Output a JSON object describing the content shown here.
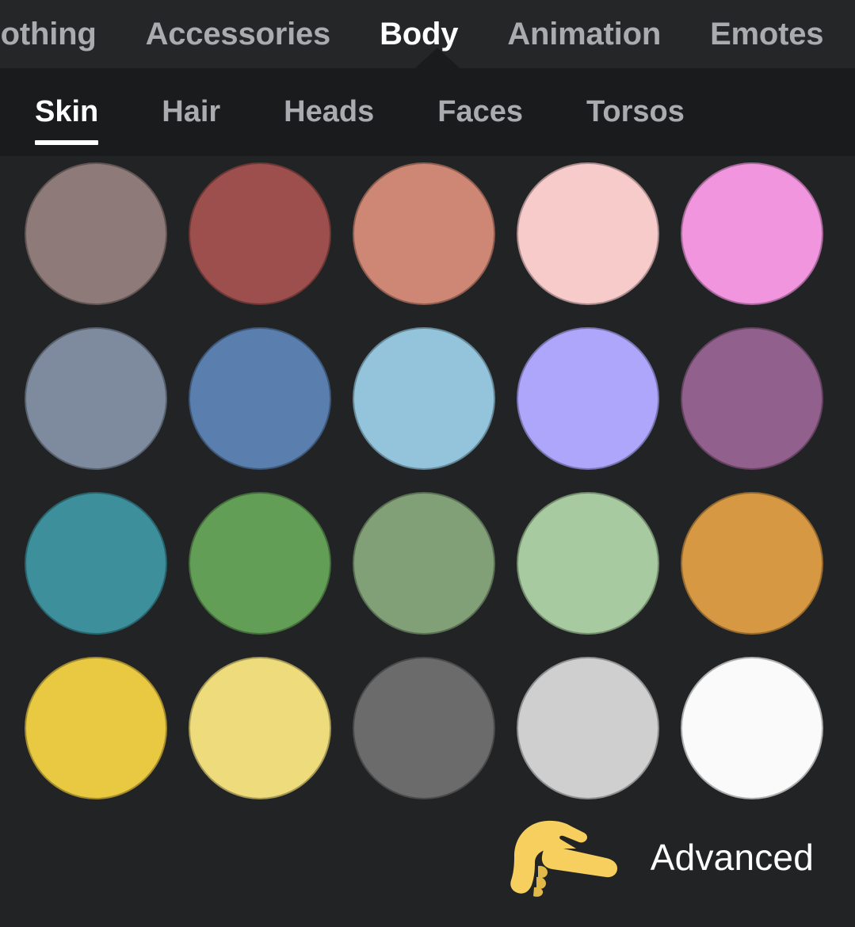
{
  "theme": {
    "top_bar_bg": "#252628",
    "sub_bar_bg": "#1a1b1d",
    "content_bg": "#222325",
    "active_text": "#ffffff",
    "inactive_text": "#a9abae",
    "accent_underline": "#ffffff"
  },
  "top_tabs": [
    {
      "label": "Clothing",
      "active": false
    },
    {
      "label": "Accessories",
      "active": false
    },
    {
      "label": "Body",
      "active": true
    },
    {
      "label": "Animation",
      "active": false
    },
    {
      "label": "Emotes",
      "active": false
    }
  ],
  "sub_tabs": [
    {
      "label": "Skin",
      "active": true
    },
    {
      "label": "Hair",
      "active": false
    },
    {
      "label": "Heads",
      "active": false
    },
    {
      "label": "Faces",
      "active": false
    },
    {
      "label": "Torsos",
      "active": false
    }
  ],
  "skin_swatches": {
    "columns": 5,
    "rows": [
      [
        {
          "name": "taupe-gray",
          "hex": "#8d7a79"
        },
        {
          "name": "brick-red",
          "hex": "#9c4f4d"
        },
        {
          "name": "salmon",
          "hex": "#ce8774"
        },
        {
          "name": "light-pink",
          "hex": "#f7cbca"
        },
        {
          "name": "bright-pink",
          "hex": "#f095de"
        }
      ],
      [
        {
          "name": "slate-blue-gray",
          "hex": "#7e8b9e"
        },
        {
          "name": "steel-blue",
          "hex": "#5a7fae"
        },
        {
          "name": "sky-blue",
          "hex": "#93c4db"
        },
        {
          "name": "periwinkle",
          "hex": "#ada6fb"
        },
        {
          "name": "mauve-purple",
          "hex": "#92608d"
        }
      ],
      [
        {
          "name": "teal",
          "hex": "#3c8f9b"
        },
        {
          "name": "medium-green",
          "hex": "#629e55"
        },
        {
          "name": "sage-green",
          "hex": "#82a077"
        },
        {
          "name": "light-green",
          "hex": "#a7caa0"
        },
        {
          "name": "orange",
          "hex": "#d79844"
        }
      ],
      [
        {
          "name": "golden-yellow",
          "hex": "#eac942"
        },
        {
          "name": "pale-yellow",
          "hex": "#eedb7c"
        },
        {
          "name": "dark-gray",
          "hex": "#6b6b6b"
        },
        {
          "name": "light-gray",
          "hex": "#cfcfcf"
        },
        {
          "name": "white",
          "hex": "#fafafa"
        }
      ]
    ]
  },
  "advanced": {
    "label": "Advanced",
    "pointer_icon": "pointing-hand-right-icon",
    "pointer_color": "#f6cf5e",
    "pointer_shadow": "#e0b94a"
  }
}
